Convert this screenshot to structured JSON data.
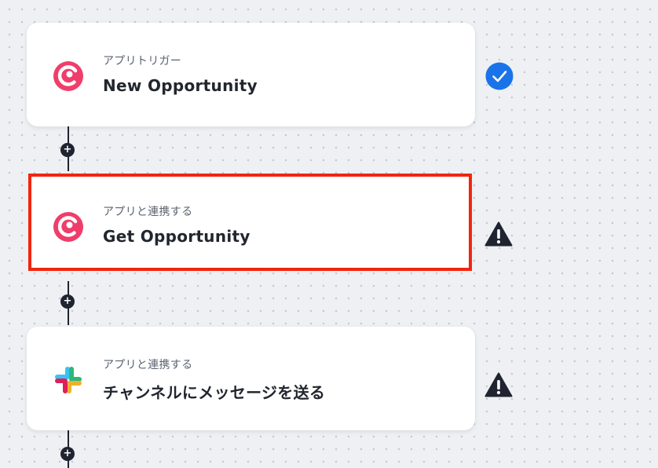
{
  "steps": [
    {
      "type_label": "アプリトリガー",
      "title": "New Opportunity",
      "app_icon": "copper-crm-icon",
      "status_icon": "check-circle-icon"
    },
    {
      "type_label": "アプリと連携する",
      "title": "Get Opportunity",
      "app_icon": "copper-crm-icon",
      "status_icon": "warning-triangle-icon"
    },
    {
      "type_label": "アプリと連携する",
      "title": "チャンネルにメッセージを送る",
      "app_icon": "slack-icon",
      "status_icon": "warning-triangle-icon"
    }
  ],
  "add_step_symbol": "+",
  "colors": {
    "copper_brand": "#ef3e6b",
    "check_blue": "#1a73e8",
    "highlight_red": "#f2250f",
    "connector": "#1f2430",
    "slack_blue": "#36c5f0",
    "slack_green": "#2eb67d",
    "slack_yellow": "#ecb22e",
    "slack_red": "#e01e5a"
  }
}
